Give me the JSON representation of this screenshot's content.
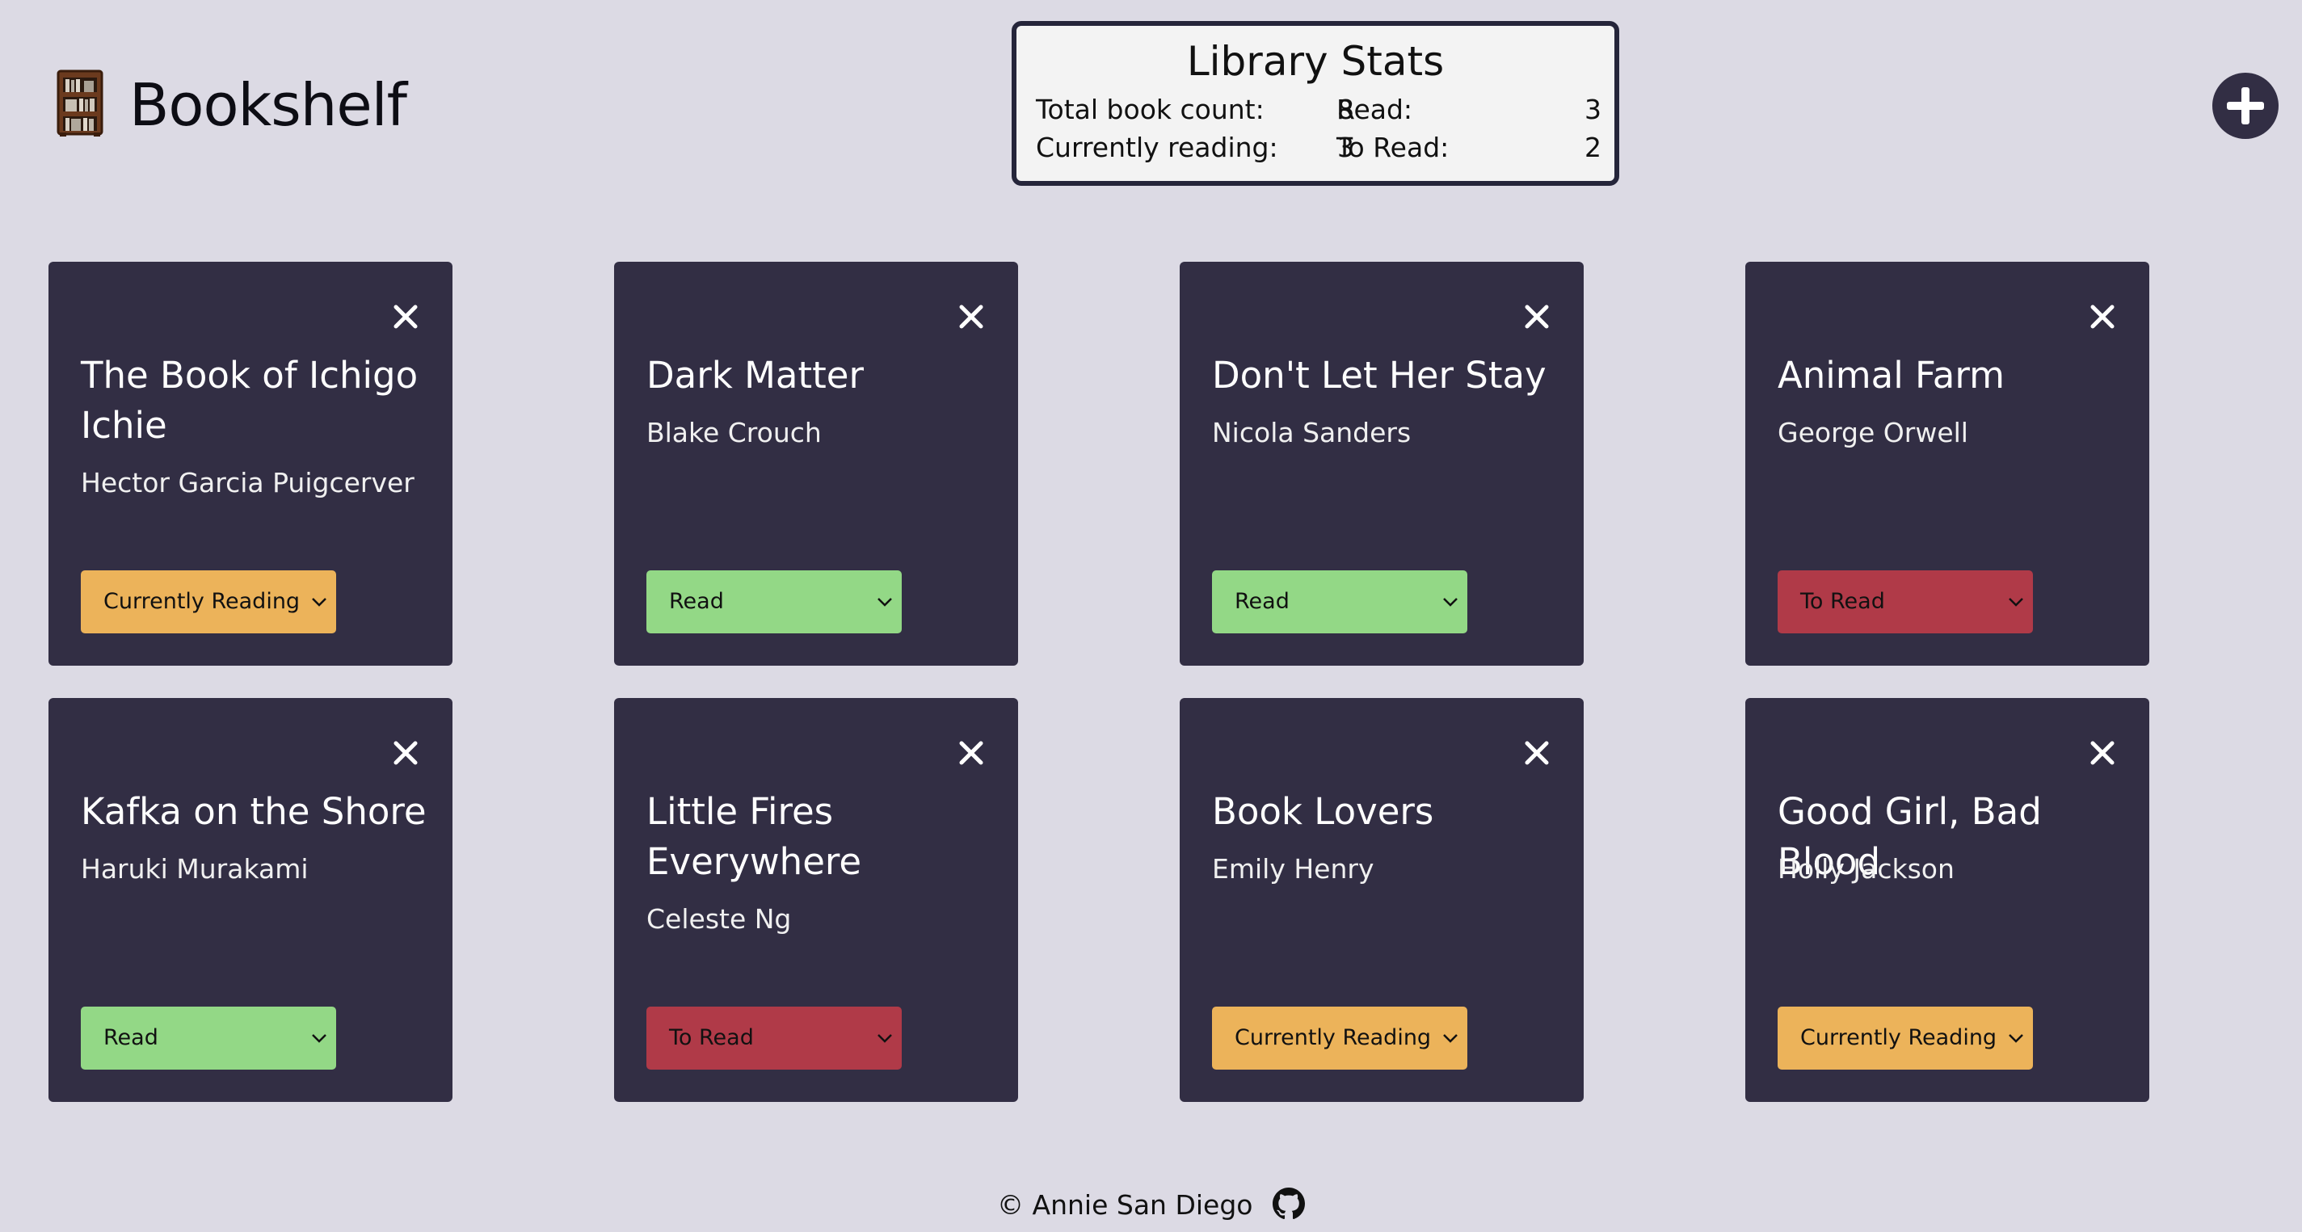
{
  "app": {
    "title": "Bookshelf"
  },
  "stats": {
    "title": "Library Stats",
    "total_label": "Total book count:",
    "total_value": "8",
    "currently_label": "Currently reading:",
    "currently_value": "3",
    "read_label": "Read:",
    "read_value": "3",
    "toread_label": "To Read:",
    "toread_value": "2"
  },
  "status_colors": {
    "Currently Reading": "#ecb35a",
    "Read": "#93d886",
    "To Read": "#b03a48"
  },
  "books": [
    {
      "title": "The Book of Ichigo Ichie",
      "author": "Hector Garcia Puigcerver",
      "status": "Currently Reading"
    },
    {
      "title": "Dark Matter",
      "author": "Blake Crouch",
      "status": "Read"
    },
    {
      "title": "Don't Let Her Stay",
      "author": "Nicola Sanders",
      "status": "Read"
    },
    {
      "title": "Animal Farm",
      "author": "George Orwell",
      "status": "To Read"
    },
    {
      "title": "Kafka on the Shore",
      "author": "Haruki Murakami",
      "status": "Read"
    },
    {
      "title": "Little Fires Everywhere",
      "author": "Celeste Ng",
      "status": "To Read"
    },
    {
      "title": "Book Lovers",
      "author": "Emily Henry",
      "status": "Currently Reading"
    },
    {
      "title": "Good Girl, Bad Blood",
      "author": "Holly Jackson",
      "status": "Currently Reading"
    }
  ],
  "icons": {
    "logo": "bookshelf-icon",
    "add": "plus-circle-icon",
    "close": "close-icon",
    "github": "github-icon"
  },
  "footer": {
    "text": "© Annie San Diego"
  }
}
